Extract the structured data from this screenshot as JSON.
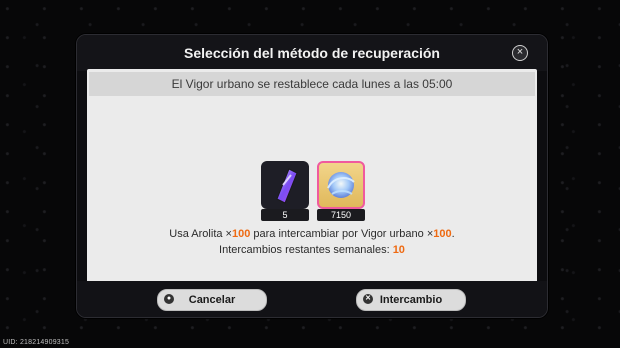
{
  "uid_text": "UID: 218214909315",
  "dialog": {
    "title": "Selección del método de recuperación",
    "close_icon": "close-icon",
    "banner": "El Vigor urbano se restablece cada lunes a las 05:00",
    "items": [
      {
        "name": "arolita-icon",
        "qty": "5"
      },
      {
        "name": "vigor-urbano-icon",
        "qty": "7150"
      }
    ],
    "exchange_text": {
      "p1": "Usa Arolita ×",
      "n1": "100",
      "p2": " para intercambiar por Vigor urbano ×",
      "n2": "100",
      "p3": "."
    },
    "weekly_text": {
      "p1": "Intercambios restantes semanales: ",
      "n1": "10"
    },
    "buttons": {
      "cancel_label": "Cancelar",
      "exchange_label": "Intercambio"
    }
  },
  "colors": {
    "accent_orange": "#ee6a12",
    "panel": "#ebebeb",
    "frame": "#0d0d10"
  }
}
